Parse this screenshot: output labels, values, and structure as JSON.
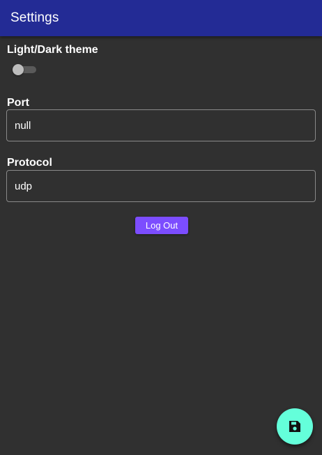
{
  "app_bar": {
    "title": "Settings",
    "background_color": "#232b95"
  },
  "theme_section": {
    "label": "Light/Dark theme",
    "toggle_on": false
  },
  "port_section": {
    "label": "Port",
    "value": "null"
  },
  "protocol_section": {
    "label": "Protocol",
    "value": "udp"
  },
  "logout_button": {
    "label": "Log Out",
    "color": "#7c4dff"
  },
  "fab": {
    "icon": "save-icon",
    "color": "#64ffda"
  },
  "background_color": "#303030"
}
